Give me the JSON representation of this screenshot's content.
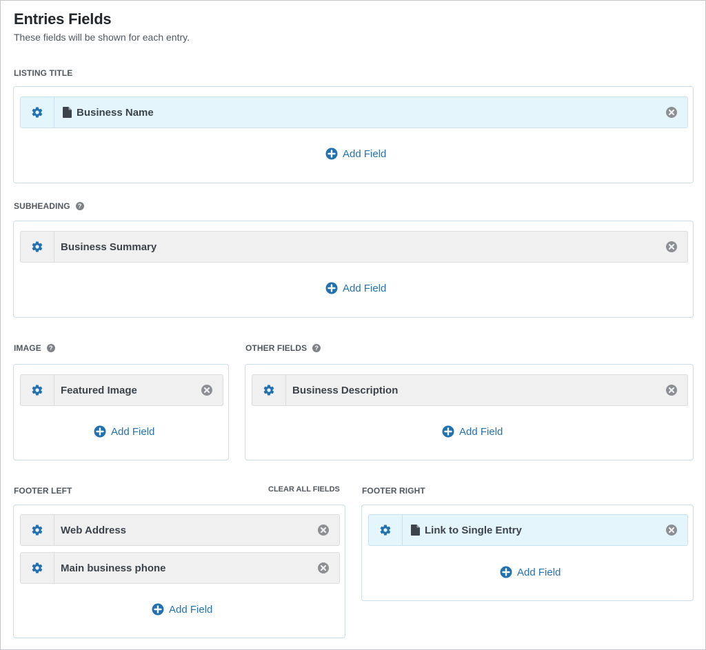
{
  "header": {
    "title": "Entries Fields",
    "subtitle": "These fields will be shown for each entry."
  },
  "add_field_label": "Add Field",
  "clear_all_label": "CLEAR ALL FIELDS",
  "sections": {
    "listing_title": {
      "label": "LISTING TITLE",
      "fields": [
        {
          "label": "Business Name",
          "icon": "document-icon"
        }
      ]
    },
    "subheading": {
      "label": "SUBHEADING",
      "fields": [
        {
          "label": "Business Summary"
        }
      ]
    },
    "image": {
      "label": "IMAGE",
      "fields": [
        {
          "label": "Featured Image"
        }
      ]
    },
    "other_fields": {
      "label": "OTHER FIELDS",
      "fields": [
        {
          "label": "Business Description"
        }
      ]
    },
    "footer_left": {
      "label": "FOOTER LEFT",
      "fields": [
        {
          "label": "Web Address"
        },
        {
          "label": "Main business phone"
        }
      ]
    },
    "footer_right": {
      "label": "FOOTER RIGHT",
      "fields": [
        {
          "label": "Link to Single Entry",
          "icon": "document-icon"
        }
      ]
    }
  },
  "colors": {
    "accent": "#2271b1",
    "highlight_field": "#e4f5fc",
    "field": "#f0f0f1",
    "area_border": "#c8dbe6"
  }
}
